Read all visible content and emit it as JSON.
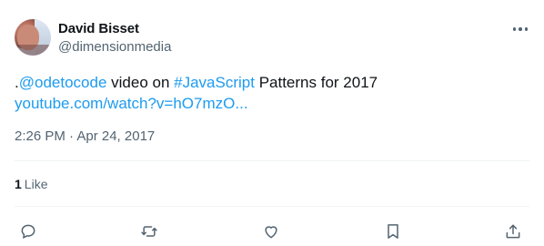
{
  "author": {
    "name": "David Bisset",
    "handle": "@dimensionmedia"
  },
  "tweet": {
    "prefix": ".",
    "mention": "@odetocode",
    "mid_text": " video on ",
    "hashtag": "#JavaScript",
    "suffix": " Patterns for 2017",
    "url_text": "youtube.com/watch?v=hO7mzO..."
  },
  "timestamp": "2:26 PM · Apr 24, 2017",
  "stats": {
    "likes_count": "1",
    "likes_label": "Like"
  },
  "actions": {
    "reply_icon": "reply-icon",
    "retweet_icon": "retweet-icon",
    "like_icon": "heart-icon",
    "bookmark_icon": "bookmark-icon",
    "share_icon": "share-icon"
  },
  "colors": {
    "link": "#1d9bf0",
    "secondary_text": "#536471",
    "primary_text": "#0f1419"
  }
}
